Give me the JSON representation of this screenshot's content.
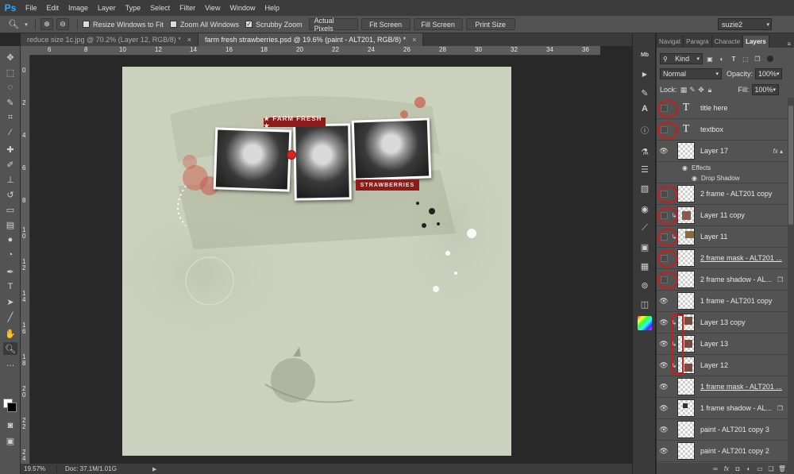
{
  "app": {
    "logo": "Ps"
  },
  "menu": [
    "File",
    "Edit",
    "Image",
    "Layer",
    "Type",
    "Select",
    "Filter",
    "View",
    "Window",
    "Help"
  ],
  "options": {
    "resize_windows": "Resize Windows to Fit",
    "zoom_all": "Zoom All Windows",
    "scrubby_zoom": "Scrubby Zoom",
    "scrubby_checked": "✓",
    "actual_pixels": "Actual Pixels",
    "fit_screen": "Fit Screen",
    "fill_screen": "Fill Screen",
    "print_size": "Print Size",
    "workspace": "suzie2"
  },
  "tabs": [
    {
      "label": "reduce size 1c.jpg @ 70.2% (Layer 12, RGB/8) *"
    },
    {
      "label": "farm fresh strawberries.psd @ 19.6% (paint - ALT201, RGB/8) *"
    }
  ],
  "ruler_top": [
    "6",
    "8",
    "10",
    "12",
    "14",
    "16",
    "18",
    "20",
    "22",
    "24",
    "26",
    "28",
    "30",
    "32",
    "34",
    "36"
  ],
  "ruler_left": [
    "0",
    "2",
    "4",
    "6",
    "8",
    "1 0",
    "1 2",
    "1 4",
    "1 6",
    "1 8",
    "2 0",
    "2 2",
    "2 4"
  ],
  "artwork": {
    "label_top": "★ FARM FRESH ★",
    "label_bottom": "STRAWBERRIES"
  },
  "status": {
    "zoom": "19.57%",
    "doc": "Doc: 37.1M/1.01G"
  },
  "panel": {
    "tabs": [
      "Navigat",
      "Paragra",
      "Characte",
      "Layers"
    ],
    "kind": "Kind",
    "blend_mode": "Normal",
    "opacity_label": "Opacity:",
    "opacity": "100%",
    "lock_label": "Lock:",
    "fill_label": "Fill:",
    "fill": "100%"
  },
  "layers": [
    {
      "name": "title here"
    },
    {
      "name": "textbox"
    },
    {
      "name": "Layer 17",
      "effects": "Effects",
      "effect": "Drop Shadow"
    },
    {
      "name": "2 frame  - ALT201 copy"
    },
    {
      "name": "Layer 11 copy"
    },
    {
      "name": "Layer 11"
    },
    {
      "name": "2 frame mask - ALT201 ..."
    },
    {
      "name": "2 frame shadow - AL..."
    },
    {
      "name": "1 frame - ALT201 copy"
    },
    {
      "name": "Layer 13 copy"
    },
    {
      "name": "Layer 13"
    },
    {
      "name": "Layer 12"
    },
    {
      "name": "1 frame mask - ALT201 ..."
    },
    {
      "name": "1 frame shadow - AL..."
    },
    {
      "name": "paint - ALT201 copy 3"
    },
    {
      "name": "paint - ALT201 copy 2"
    }
  ]
}
